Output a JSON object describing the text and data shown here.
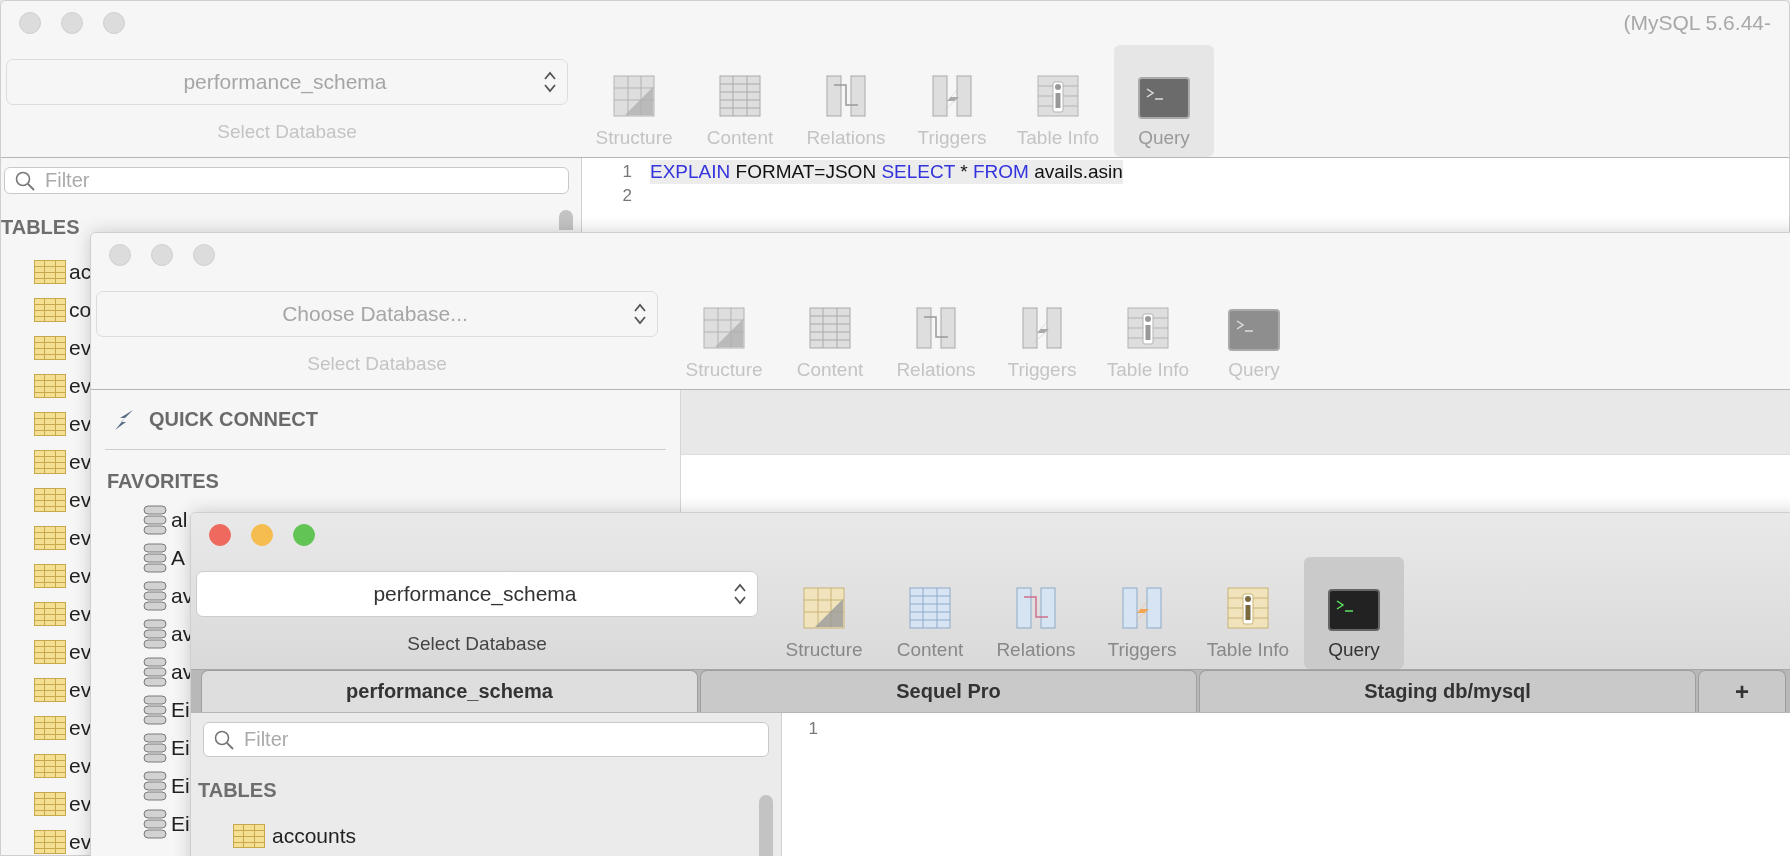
{
  "windows": [
    {
      "kind": "connected",
      "active": false,
      "title": "(MySQL 5.6.44-",
      "database_select": {
        "value": "performance_schema"
      },
      "database_label": "Select Database",
      "toolbar": [
        {
          "kind": "structure",
          "label": "Structure",
          "selected": false
        },
        {
          "kind": "content",
          "label": "Content",
          "selected": false
        },
        {
          "kind": "relations",
          "label": "Relations",
          "selected": false
        },
        {
          "kind": "triggers",
          "label": "Triggers",
          "selected": false
        },
        {
          "kind": "info",
          "label": "Table Info",
          "selected": false
        },
        {
          "kind": "query",
          "label": "Query",
          "selected": true
        }
      ],
      "sidebar": {
        "filter_placeholder": "Filter",
        "section": "TABLES",
        "items": [
          "ac",
          "co",
          "ev",
          "ev",
          "ev",
          "ev",
          "ev",
          "ev",
          "ev",
          "ev",
          "ev",
          "ev",
          "ev",
          "ev",
          "ev",
          "ev"
        ]
      },
      "editor": {
        "lines": [
          {
            "number": "1",
            "tokens": [
              {
                "kind": "keyword",
                "text": "EXPLAIN"
              },
              {
                "kind": "plain",
                "text": " FORMAT=JSON "
              },
              {
                "kind": "keyword",
                "text": "SELECT"
              },
              {
                "kind": "plain",
                "text": " * "
              },
              {
                "kind": "keyword",
                "text": "FROM"
              },
              {
                "kind": "plain",
                "text": " avails.asin"
              }
            ]
          },
          {
            "number": "2"
          }
        ]
      }
    },
    {
      "kind": "welcome",
      "active": false,
      "database_select": {
        "placeholder": "Choose Database..."
      },
      "database_label": "Select Database",
      "toolbar": [
        {
          "kind": "structure",
          "label": "Structure",
          "selected": false
        },
        {
          "kind": "content",
          "label": "Content",
          "selected": false
        },
        {
          "kind": "relations",
          "label": "Relations",
          "selected": false
        },
        {
          "kind": "triggers",
          "label": "Triggers",
          "selected": false
        },
        {
          "kind": "info",
          "label": "Table Info",
          "selected": false
        },
        {
          "kind": "query",
          "label": "Query",
          "selected": false
        }
      ],
      "sidebar": {
        "quick_connect": "QUICK CONNECT",
        "section": "FAVORITES",
        "items": [
          "al",
          "A",
          "av",
          "av",
          "av",
          "Ei",
          "Ei",
          "Ei",
          "Ei"
        ]
      }
    },
    {
      "kind": "connected",
      "active": true,
      "database_select": {
        "value": "performance_schema"
      },
      "database_label": "Select Database",
      "toolbar": [
        {
          "kind": "structure",
          "label": "Structure",
          "selected": false
        },
        {
          "kind": "content",
          "label": "Content",
          "selected": false
        },
        {
          "kind": "relations",
          "label": "Relations",
          "selected": false
        },
        {
          "kind": "triggers",
          "label": "Triggers",
          "selected": false
        },
        {
          "kind": "info",
          "label": "Table Info",
          "selected": false
        },
        {
          "kind": "query",
          "label": "Query",
          "selected": true
        }
      ],
      "tabs": [
        {
          "label": "performance_schema",
          "selected": true
        },
        {
          "label": "Sequel Pro",
          "selected": false
        },
        {
          "label": "Staging db/mysql",
          "selected": false
        }
      ],
      "add_tab": "+",
      "sidebar": {
        "filter_placeholder": "Filter",
        "section": "TABLES",
        "items": [
          "accounts"
        ]
      },
      "editor": {
        "lines": [
          {
            "number": "1"
          }
        ]
      }
    }
  ]
}
